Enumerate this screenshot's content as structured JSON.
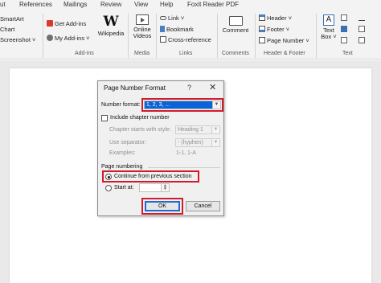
{
  "ribbon_tabs": [
    "ut",
    "References",
    "Mailings",
    "Review",
    "View",
    "Help",
    "Foxit Reader PDF"
  ],
  "ribbon": {
    "left_items": [
      "SmartArt",
      "Chart",
      "Screenshot ˅"
    ],
    "addins": {
      "get_addins": "Get Add-ins",
      "my_addins": "My Add-ins ˅",
      "wikipedia": "Wikipedia",
      "group": "Add-ins"
    },
    "media": {
      "online_videos": "Online Videos",
      "group": "Media"
    },
    "links": {
      "link": "Link ˅",
      "bookmark": "Bookmark",
      "cross_reference": "Cross-reference",
      "group": "Links"
    },
    "comments": {
      "comment": "Comment",
      "group": "Comments"
    },
    "header_footer": {
      "header": "Header ˅",
      "footer": "Footer ˅",
      "page_number": "Page Number ˅",
      "group": "Header & Footer"
    },
    "text": {
      "text_box": "Text Box ˅",
      "group": "Text"
    }
  },
  "dialog": {
    "title": "Page Number Format",
    "help": "?",
    "close": "✕",
    "number_format_label": "Number format:",
    "number_format_value": "1, 2, 3, ...",
    "include_chapter_label": "Include chapter number",
    "include_chapter_checked": false,
    "chapter_style_label": "Chapter starts with style:",
    "chapter_style_value": "Heading 1",
    "separator_label": "Use separator:",
    "separator_value": "-  (hyphen)",
    "examples_label": "Examples:",
    "examples_value": "1-1, 1-A",
    "page_numbering_label": "Page numbering",
    "continue_label": "Continue from previous section",
    "start_at_label": "Start at:",
    "start_at_value": "",
    "ok": "OK",
    "cancel": "Cancel"
  },
  "colors": {
    "highlight": "#d11b2a",
    "selection": "#0a64d8"
  }
}
